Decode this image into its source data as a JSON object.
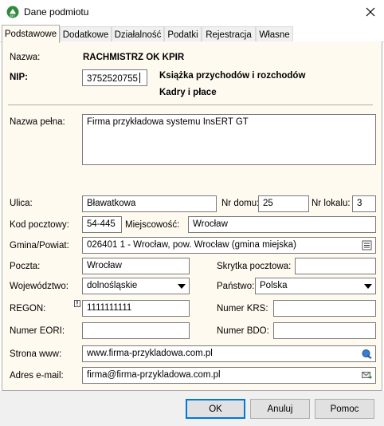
{
  "window": {
    "title": "Dane podmiotu",
    "app_icon": "insert-gt-logo-icon",
    "close_icon": "close-icon"
  },
  "tabs": [
    {
      "label": "Podstawowe",
      "active": true
    },
    {
      "label": "Dodatkowe"
    },
    {
      "label": "Działalność"
    },
    {
      "label": "Podatki"
    },
    {
      "label": "Rejestracja"
    },
    {
      "label": "Własne"
    }
  ],
  "header": {
    "nazwa_label": "Nazwa:",
    "nazwa_value": "RACHMISTRZ OK KPIR",
    "nip_label": "NIP:",
    "nip_value": "3752520755",
    "info_line1": "Książka przychodów i rozchodów",
    "info_line2": "Kadry i płace"
  },
  "form": {
    "nazwa_pelna_label": "Nazwa pełna:",
    "nazwa_pelna_value": "Firma przykładowa systemu InsERT GT",
    "ulica_label": "Ulica:",
    "ulica_value": "Bławatkowa",
    "nr_domu_label": "Nr domu:",
    "nr_domu_value": "25",
    "nr_lokalu_label": "Nr lokalu:",
    "nr_lokalu_value": "3",
    "kod_label": "Kod pocztowy:",
    "kod_value": "54-445",
    "miejscowosc_label": "Miejscowość:",
    "miejscowosc_value": "Wrocław",
    "gmina_label": "Gmina/Powiat:",
    "gmina_value": "026401 1 - Wrocław, pow. Wrocław (gmina miejska)",
    "poczta_label": "Poczta:",
    "poczta_value": "Wrocław",
    "skrytka_label": "Skrytka pocztowa:",
    "skrytka_value": "",
    "wojewodztwo_label": "Województwo:",
    "wojewodztwo_value": "dolnośląskie",
    "panstwo_label": "Państwo:",
    "panstwo_value": "Polska",
    "regon_label": "REGON:",
    "regon_value": "1111111111",
    "krs_label": "Numer KRS:",
    "krs_value": "",
    "eori_label": "Numer EORI:",
    "eori_value": "",
    "bdo_label": "Numer BDO:",
    "bdo_value": "",
    "www_label": "Strona www:",
    "www_value": "www.firma-przykladowa.com.pl",
    "email_label": "Adres e-mail:",
    "email_value": "firma@firma-przykladowa.com.pl",
    "warning_mark": "!"
  },
  "buttons": {
    "ok": "OK",
    "cancel": "Anuluj",
    "help": "Pomoc"
  }
}
